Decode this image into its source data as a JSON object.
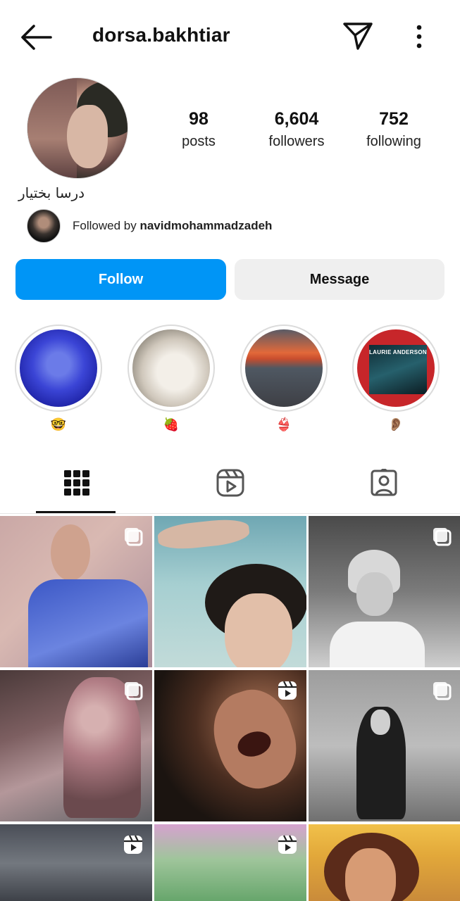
{
  "header": {
    "username": "dorsa.bakhtiar",
    "back_icon": "arrow-left-icon",
    "send_icon": "paper-plane-icon",
    "more_icon": "more-vertical-icon"
  },
  "profile": {
    "display_name": "درسا بختیار",
    "stats": {
      "posts": {
        "value": "98",
        "label": "posts"
      },
      "followers": {
        "value": "6,604",
        "label": "followers"
      },
      "following": {
        "value": "752",
        "label": "following"
      }
    },
    "followed_by_prefix": "Followed by",
    "followed_by_user": "navidmohammadzadeh"
  },
  "actions": {
    "follow_label": "Follow",
    "message_label": "Message"
  },
  "highlights": [
    {
      "emoji": "🤓"
    },
    {
      "emoji": "🍓"
    },
    {
      "emoji": "👙"
    },
    {
      "emoji": "👂🏽"
    }
  ],
  "highlight_album_text": "LAURIE ANDERSON",
  "tabs": [
    {
      "name": "posts-grid",
      "icon": "grid-icon",
      "active": true
    },
    {
      "name": "reels",
      "icon": "reels-icon",
      "active": false
    },
    {
      "name": "tagged",
      "icon": "tagged-user-icon",
      "active": false
    }
  ],
  "posts": [
    {
      "badge": "carousel"
    },
    {
      "badge": "none"
    },
    {
      "badge": "carousel"
    },
    {
      "badge": "carousel"
    },
    {
      "badge": "reel"
    },
    {
      "badge": "carousel"
    },
    {
      "badge": "reel"
    },
    {
      "badge": "reel"
    },
    {
      "badge": "none"
    }
  ],
  "colors": {
    "accent": "#0095f6",
    "secondary_button": "#efefef",
    "text": "#111111"
  }
}
